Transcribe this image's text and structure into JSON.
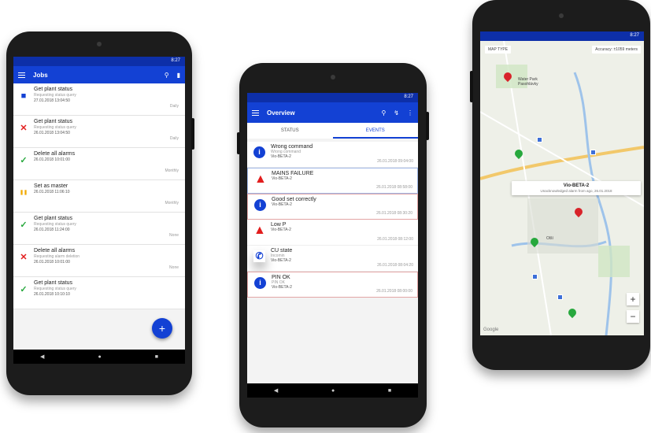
{
  "jobs_screen": {
    "status_time": "8:27",
    "title": "Jobs",
    "search_icon": "search-icon",
    "jobs": [
      {
        "icon": "blue-square",
        "title": "Get plant status",
        "sub": "Requesting status query",
        "date": "27.01.2018 13:04:50",
        "repeat": "Daily"
      },
      {
        "icon": "red-x",
        "title": "Get plant status",
        "sub": "Requesting status query",
        "date": "26.01.2018 13:04:50",
        "repeat": "Daily"
      },
      {
        "icon": "green-check",
        "title": "Delete all alarms",
        "sub": "",
        "date": "26.01.2018 10:01:00",
        "repeat": "Monthly"
      },
      {
        "icon": "pause",
        "title": "Set as master",
        "sub": "",
        "date": "26.01.2018 11:06:10",
        "repeat": "Monthly"
      },
      {
        "icon": "green-check",
        "title": "Get plant status",
        "sub": "Requesting status query",
        "date": "26.01.2018 11:24:00",
        "repeat": "None"
      },
      {
        "icon": "red-x",
        "title": "Delete all alarms",
        "sub": "Requesting alarm deletion",
        "date": "26.01.2018 10:01:00",
        "repeat": "None"
      },
      {
        "icon": "green-check",
        "title": "Get plant status",
        "sub": "Requesting status query",
        "date": "26.01.2018 10:10:10",
        "repeat": ""
      }
    ],
    "fab_label": "+"
  },
  "overview_screen": {
    "status_time": "8:27",
    "title": "Overview",
    "tabs": [
      "STATUS",
      "EVENTS"
    ],
    "events": [
      {
        "icon": "info",
        "title": "Wrong command",
        "sub": "Wrong command",
        "unit": "Vio-BETA-2",
        "date": "26.01.2018 09:04:00",
        "hl": ""
      },
      {
        "icon": "warning",
        "title": "MAINS FAILURE",
        "sub": "",
        "unit": "Vio-BETA-2",
        "date": "26.01.2018 08:58:00",
        "hl": "hl2"
      },
      {
        "icon": "info",
        "title": "Good set correctly",
        "sub": "",
        "unit": "Vio-BETA-2",
        "date": "26.01.2018 08:30:20",
        "hl": "hl"
      },
      {
        "icon": "warning",
        "title": "Low P",
        "sub": "",
        "unit": "Vio-BETA-2",
        "date": "26.01.2018 08:12:00",
        "hl": ""
      },
      {
        "icon": "phone",
        "title": "CU state",
        "sub": "Incomin",
        "unit": "Vio-BETA-2",
        "date": "26.01.2018 08:04:20",
        "hl": ""
      },
      {
        "icon": "info",
        "title": "PIN OK",
        "sub": "PIN OK",
        "unit": "Vio-BETA-2",
        "date": "26.01.2018 08:00:00",
        "hl": "hl"
      }
    ]
  },
  "map_screen": {
    "status_time": "8:27",
    "map_type": "MAP TYPE",
    "accuracy": "Accuracy: ±1059 meters",
    "info_title": "Vio-BETA-2",
    "info_sub": "Unacknowledged alarm from ago, 26.01.2018",
    "labels": [
      "Water Park Pasohlávky",
      "Olší"
    ],
    "google": "Google",
    "zoom_in": "+",
    "zoom_out": "−"
  }
}
